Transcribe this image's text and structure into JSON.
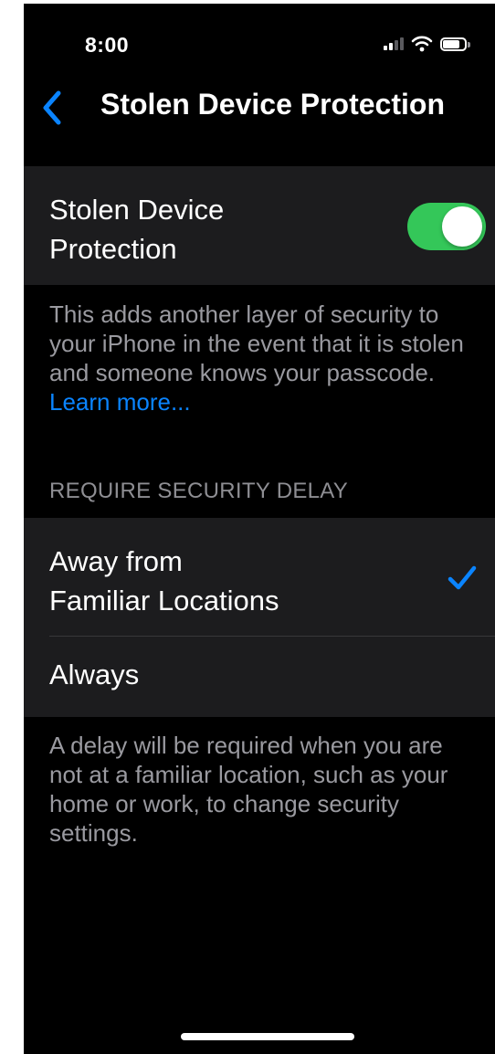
{
  "status_bar": {
    "time": "8:00"
  },
  "nav": {
    "title": "Stolen Device Protection",
    "back_icon": "chevron-left-icon"
  },
  "toggle_group": {
    "label_line1": "Stolen Device",
    "label_line2": "Protection",
    "enabled": true
  },
  "toggle_footer": {
    "text": "This adds another layer of security to your iPhone in the event that it is stolen and someone knows your passcode. ",
    "link": "Learn more..."
  },
  "delay_section": {
    "header": "REQUIRE SECURITY DELAY",
    "options": [
      {
        "label_line1": "Away from",
        "label_line2": "Familiar Locations",
        "selected": true
      },
      {
        "label_line1": "Always",
        "selected": false
      }
    ],
    "footer": "A delay will be required when you are not at a familiar location, such as your home or work, to change security settings."
  },
  "colors": {
    "accent": "#0a84ff",
    "toggle_on": "#34c759",
    "cell_background": "#1c1c1e",
    "secondary_text": "#9a9aa0"
  }
}
